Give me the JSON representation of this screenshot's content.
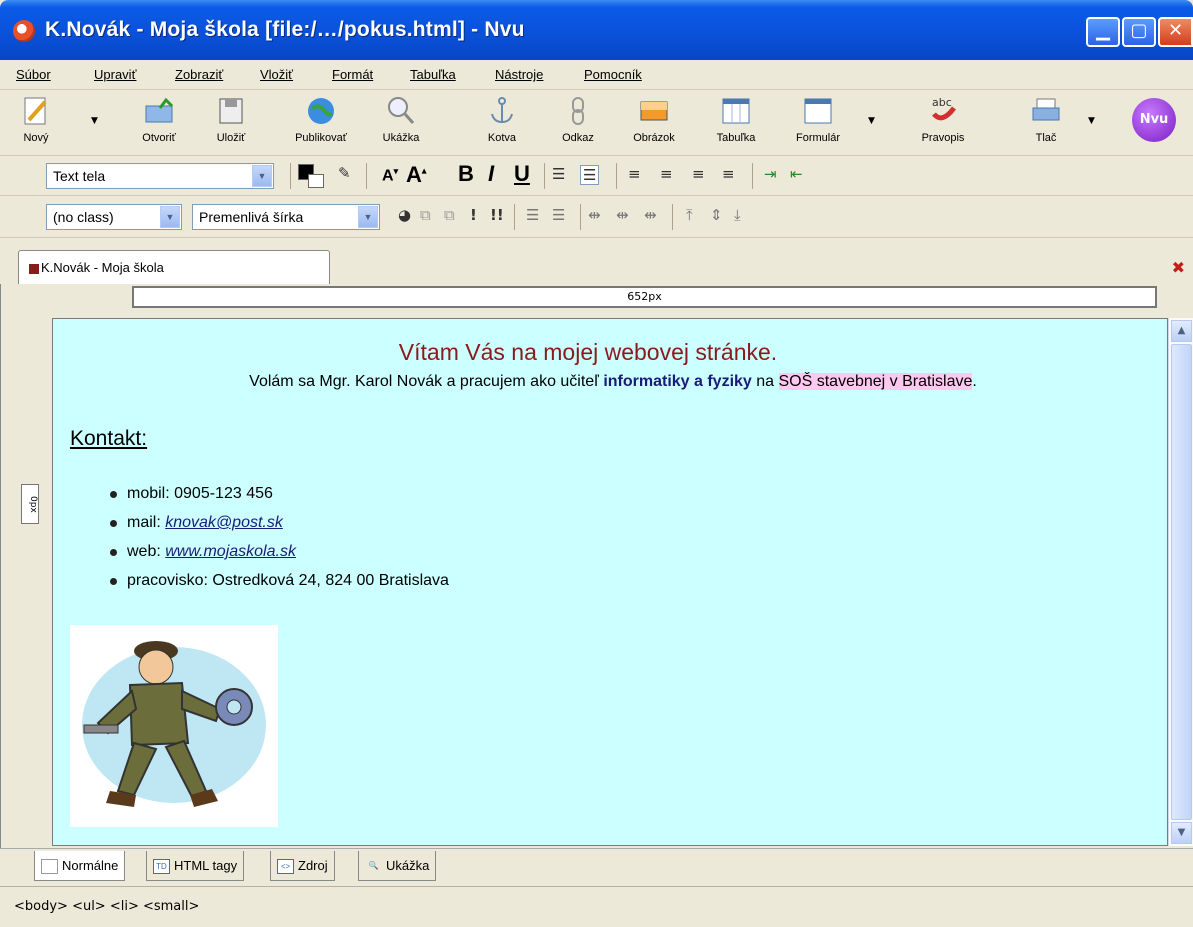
{
  "window": {
    "title": "K.Novák - Moja škola [file:/…/pokus.html] - Nvu"
  },
  "menu": [
    "Súbor",
    "Upraviť",
    "Zobraziť",
    "Vložiť",
    "Formát",
    "Tabuľka",
    "Nástroje",
    "Pomocník"
  ],
  "toolbar": {
    "new": "Nový",
    "open": "Otvoriť",
    "save": "Uložiť",
    "publish": "Publikovať",
    "preview": "Ukážka",
    "anchor": "Kotva",
    "link": "Odkaz",
    "image": "Obrázok",
    "table": "Tabuľka",
    "form": "Formulár",
    "spell": "Pravopis",
    "print": "Tlač",
    "spell_badge": "abc",
    "logo": "Nvu"
  },
  "format": {
    "paragraph_style": "Text tela",
    "class": "(no class)",
    "font": "Premenlivá šírka"
  },
  "tab": {
    "label": "K.Novák - Moja škola"
  },
  "ruler": {
    "width_label": "652px",
    "height_label": "0px"
  },
  "page": {
    "heading": "Vítam Vás na mojej webovej stránke.",
    "intro_a": "Volám sa Mgr. Karol Novák a pracujem ako učiteľ ",
    "intro_bold": "informatiky a fyziky",
    "intro_b": " na ",
    "intro_highlight": "SOŠ stavebnej  v Bratislave",
    "intro_end": ".",
    "contact_heading": "Kontakt:",
    "contacts": {
      "mobile": "mobil: 0905-123 456",
      "mail_label": "mail: ",
      "mail": "knovak@post.sk",
      "web_label": "web: ",
      "web": "www.mojaskola.sk",
      "workplace": "pracovisko: Ostredková 24, 824 00 Bratislava"
    }
  },
  "mode_tabs": {
    "normal": "Normálne",
    "html_tags": "HTML tagy",
    "source": "Zdroj",
    "preview": "Ukážka"
  },
  "status": {
    "path": "<body> <ul> <li> <small>"
  },
  "colors": {
    "titlebar": "#0a50d8",
    "editor_bg": "#ccffff",
    "heading": "#8b1a1a",
    "bold_text": "#1a1a7a",
    "highlight": "#ffc8f0"
  }
}
